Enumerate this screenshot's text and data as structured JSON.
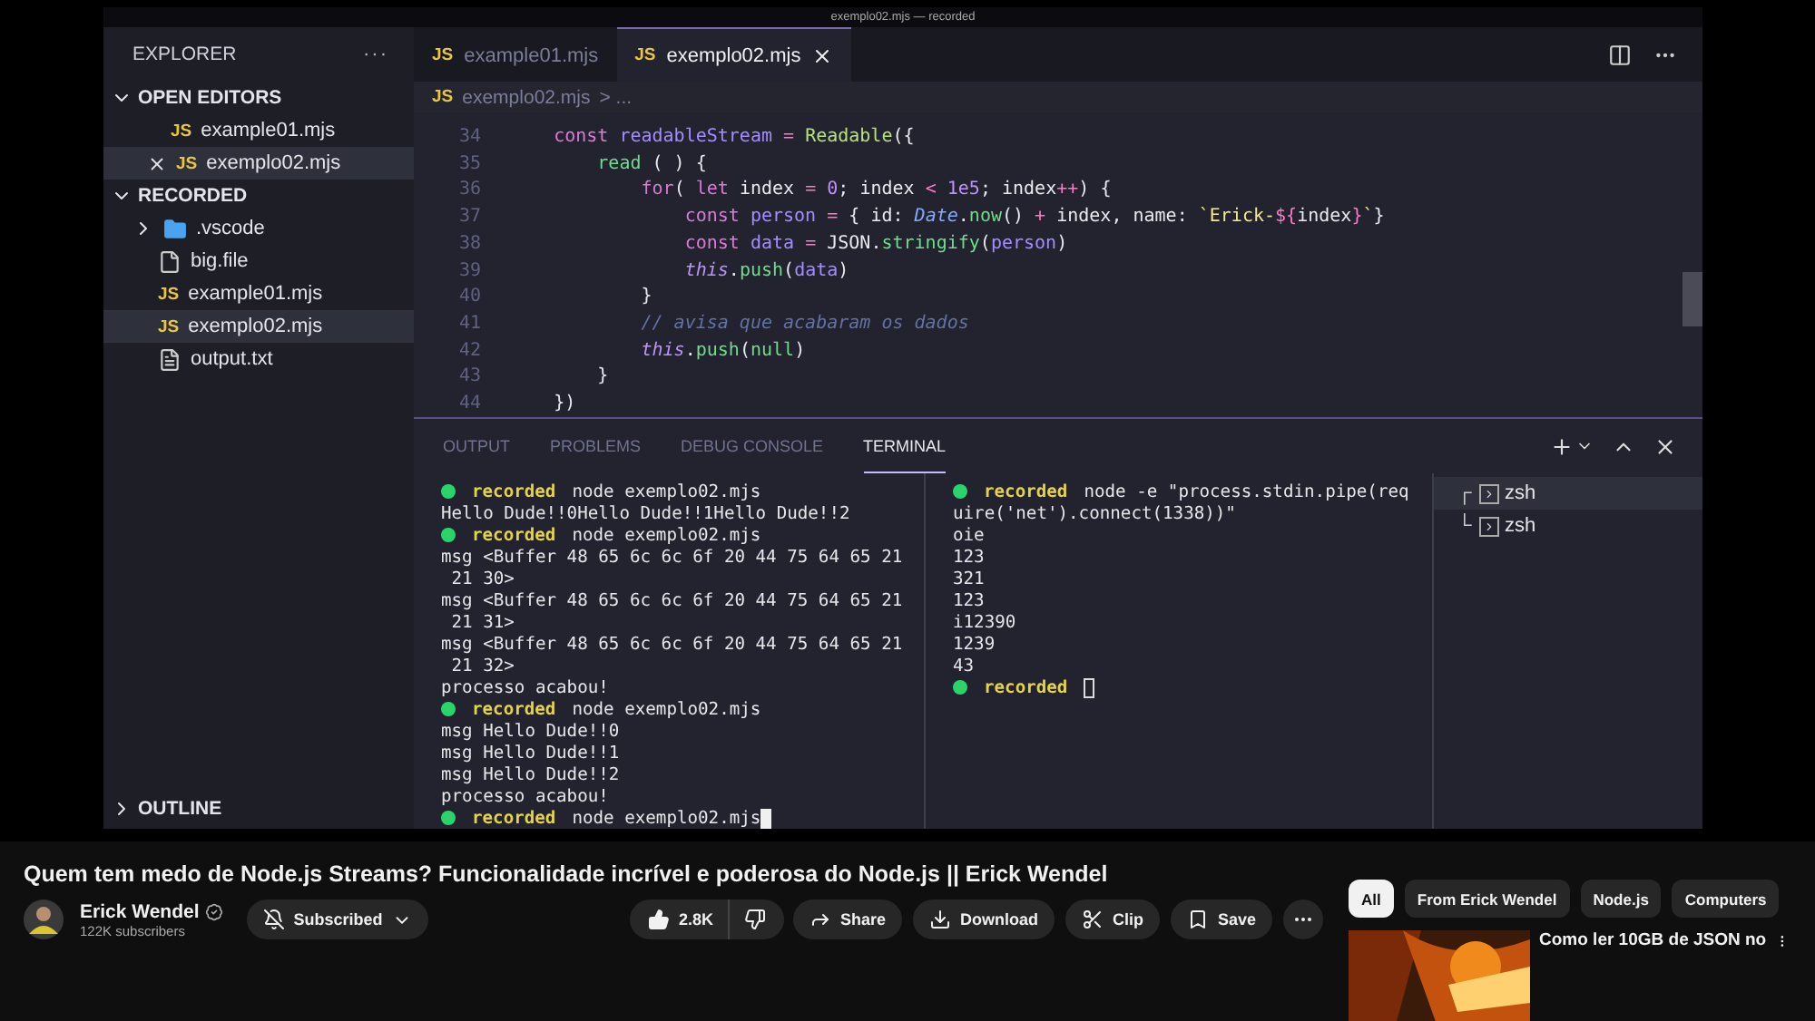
{
  "window": {
    "title": "exemplo02.mjs — recorded"
  },
  "sidebar": {
    "title": "EXPLORER",
    "more": "···",
    "sections": [
      {
        "title": "OPEN EDITORS",
        "expanded": true,
        "items": [
          {
            "kind": "js",
            "badge": "JS",
            "name": "example01.mjs",
            "selected": false
          },
          {
            "kind": "js",
            "badge": "JS",
            "name": "exemplo02.mjs",
            "selected": true
          }
        ]
      },
      {
        "title": "RECORDED",
        "expanded": true,
        "items": [
          {
            "kind": "folder",
            "name": ".vscode",
            "selected": false,
            "expanded": false
          },
          {
            "kind": "file",
            "name": "big.file",
            "selected": false
          },
          {
            "kind": "js",
            "badge": "JS",
            "name": "example01.mjs",
            "selected": false
          },
          {
            "kind": "js",
            "badge": "JS",
            "name": "exemplo02.mjs",
            "selected": true
          },
          {
            "kind": "text",
            "name": "output.txt",
            "selected": false
          }
        ]
      }
    ],
    "outline": {
      "title": "OUTLINE",
      "expanded": false
    }
  },
  "tabs": [
    {
      "badge": "JS",
      "label": "example01.mjs",
      "selected": false
    },
    {
      "badge": "JS",
      "label": "exemplo02.mjs",
      "selected": true
    }
  ],
  "breadcrumb": {
    "badge": "JS",
    "file": "exemplo02.mjs",
    "rest": "> ..."
  },
  "code": [
    {
      "number": "34",
      "tokens": [
        {
          "kind": "keyword",
          "text": "    const"
        },
        {
          "kind": "variable",
          "text": " readableStream"
        },
        {
          "kind": "operator",
          "text": " = "
        },
        {
          "kind": "class",
          "text": "Readable"
        },
        {
          "kind": "plain",
          "text": "({"
        }
      ]
    },
    {
      "number": "35",
      "tokens": [
        {
          "kind": "function",
          "text": "        read"
        },
        {
          "kind": "plain",
          "text": " ( ) {"
        }
      ]
    },
    {
      "number": "36",
      "tokens": [
        {
          "kind": "keyword",
          "text": "            for"
        },
        {
          "kind": "plain",
          "text": "( "
        },
        {
          "kind": "keyword",
          "text": "let"
        },
        {
          "kind": "plain",
          "text": " index "
        },
        {
          "kind": "operator",
          "text": "="
        },
        {
          "kind": "number",
          "text": " 0"
        },
        {
          "kind": "plain",
          "text": "; index "
        },
        {
          "kind": "operator",
          "text": "<"
        },
        {
          "kind": "number",
          "text": " 1e5"
        },
        {
          "kind": "plain",
          "text": "; index"
        },
        {
          "kind": "operator",
          "text": "++"
        },
        {
          "kind": "plain",
          "text": ") {"
        }
      ]
    },
    {
      "number": "37",
      "tokens": [
        {
          "kind": "keyword",
          "text": "                const"
        },
        {
          "kind": "variable",
          "text": " person"
        },
        {
          "kind": "operator",
          "text": " ="
        },
        {
          "kind": "plain",
          "text": " { id: "
        },
        {
          "kind": "type",
          "text": "Date"
        },
        {
          "kind": "plain",
          "text": "."
        },
        {
          "kind": "function",
          "text": "now"
        },
        {
          "kind": "plain",
          "text": "() "
        },
        {
          "kind": "operator",
          "text": "+"
        },
        {
          "kind": "plain",
          "text": " index, name: "
        },
        {
          "kind": "string",
          "text": "`Erick-"
        },
        {
          "kind": "operator",
          "text": "${"
        },
        {
          "kind": "plain",
          "text": "index"
        },
        {
          "kind": "operator",
          "text": "}"
        },
        {
          "kind": "string",
          "text": "`"
        },
        {
          "kind": "plain",
          "text": "}"
        }
      ]
    },
    {
      "number": "38",
      "tokens": [
        {
          "kind": "keyword",
          "text": "                const"
        },
        {
          "kind": "variable",
          "text": " data"
        },
        {
          "kind": "operator",
          "text": " ="
        },
        {
          "kind": "plain",
          "text": " JSON."
        },
        {
          "kind": "function",
          "text": "stringify"
        },
        {
          "kind": "plain",
          "text": "("
        },
        {
          "kind": "variable",
          "text": "person"
        },
        {
          "kind": "plain",
          "text": ")"
        }
      ]
    },
    {
      "number": "39",
      "tokens": [
        {
          "kind": "this",
          "text": "                this"
        },
        {
          "kind": "plain",
          "text": "."
        },
        {
          "kind": "function",
          "text": "push"
        },
        {
          "kind": "plain",
          "text": "("
        },
        {
          "kind": "variable",
          "text": "data"
        },
        {
          "kind": "plain",
          "text": ")"
        }
      ]
    },
    {
      "number": "40",
      "tokens": [
        {
          "kind": "plain",
          "text": "            }"
        }
      ]
    },
    {
      "number": "41",
      "tokens": [
        {
          "kind": "comment",
          "text": "            // avisa que acabaram os dados"
        }
      ]
    },
    {
      "number": "42",
      "tokens": [
        {
          "kind": "this",
          "text": "            this"
        },
        {
          "kind": "plain",
          "text": "."
        },
        {
          "kind": "function",
          "text": "push"
        },
        {
          "kind": "plain",
          "text": "("
        },
        {
          "kind": "function",
          "text": "null"
        },
        {
          "kind": "plain",
          "text": ")"
        }
      ]
    },
    {
      "number": "43",
      "tokens": [
        {
          "kind": "plain",
          "text": "        }"
        }
      ]
    },
    {
      "number": "44",
      "tokens": [
        {
          "kind": "plain",
          "text": "    })"
        }
      ]
    }
  ],
  "panel": {
    "tabs": [
      {
        "label": "OUTPUT",
        "selected": false
      },
      {
        "label": "PROBLEMS",
        "selected": false
      },
      {
        "label": "DEBUG CONSOLE",
        "selected": false
      },
      {
        "label": "TERMINAL",
        "selected": true
      }
    ],
    "terminals": [
      {
        "focused": true,
        "lines": [
          {
            "kind": "prompt",
            "user": "recorded",
            "command": "node exemplo02.mjs"
          },
          {
            "kind": "output",
            "text": "Hello Dude!!0Hello Dude!!1Hello Dude!!2"
          },
          {
            "kind": "prompt",
            "user": "recorded",
            "command": "node exemplo02.mjs"
          },
          {
            "kind": "output",
            "text": "msg <Buffer 48 65 6c 6c 6f 20 44 75 64 65 21"
          },
          {
            "kind": "output",
            "text": " 21 30>"
          },
          {
            "kind": "output",
            "text": "msg <Buffer 48 65 6c 6c 6f 20 44 75 64 65 21"
          },
          {
            "kind": "output",
            "text": " 21 31>"
          },
          {
            "kind": "output",
            "text": "msg <Buffer 48 65 6c 6c 6f 20 44 75 64 65 21"
          },
          {
            "kind": "output",
            "text": " 21 32>"
          },
          {
            "kind": "output",
            "text": "processo acabou!"
          },
          {
            "kind": "prompt",
            "user": "recorded",
            "command": "node exemplo02.mjs"
          },
          {
            "kind": "output",
            "text": "msg Hello Dude!!0"
          },
          {
            "kind": "output",
            "text": "msg Hello Dude!!1"
          },
          {
            "kind": "output",
            "text": "msg Hello Dude!!2"
          },
          {
            "kind": "output",
            "text": "processo acabou!"
          },
          {
            "kind": "prompt",
            "user": "recorded",
            "command": "node exemplo02.mjs",
            "cursor": true
          }
        ]
      },
      {
        "focused": false,
        "lines": [
          {
            "kind": "prompt",
            "user": "recorded",
            "command": "node -e \"process.stdin.pipe(req"
          },
          {
            "kind": "output",
            "text": "uire('net').connect(1338))\""
          },
          {
            "kind": "output",
            "text": "oie"
          },
          {
            "kind": "output",
            "text": "123"
          },
          {
            "kind": "output",
            "text": "321"
          },
          {
            "kind": "output",
            "text": "123"
          },
          {
            "kind": "output",
            "text": "i12390"
          },
          {
            "kind": "output",
            "text": "1239"
          },
          {
            "kind": "output",
            "text": "43"
          },
          {
            "kind": "prompt",
            "user": "recorded",
            "cursor": true
          }
        ]
      }
    ],
    "shells": [
      {
        "tree": "┌",
        "name": "zsh",
        "selected": true
      },
      {
        "tree": "└",
        "name": "zsh",
        "selected": false
      }
    ]
  },
  "video": {
    "title": "Quem tem medo de Node.js Streams? Funcionalidade incrível e poderosa do Node.js || Erick Wendel",
    "channel": {
      "name": "Erick Wendel",
      "verified": true,
      "subscribers": "122K subscribers"
    },
    "subscribe": {
      "label": "Subscribed",
      "subscribed": true
    },
    "likes": "2.8K",
    "actions": [
      {
        "kind": "share",
        "label": "Share"
      },
      {
        "kind": "download",
        "label": "Download"
      },
      {
        "kind": "clip",
        "label": "Clip"
      },
      {
        "kind": "save",
        "label": "Save"
      },
      {
        "kind": "more"
      }
    ]
  },
  "chips": [
    {
      "label": "All",
      "selected": true
    },
    {
      "label": "From Erick Wendel",
      "selected": false
    },
    {
      "label": "Node.js",
      "selected": false
    },
    {
      "label": "Computers",
      "selected": false
    }
  ],
  "recommendation": {
    "kind": "picture",
    "title": "Como ler 10GB de JSON no"
  }
}
